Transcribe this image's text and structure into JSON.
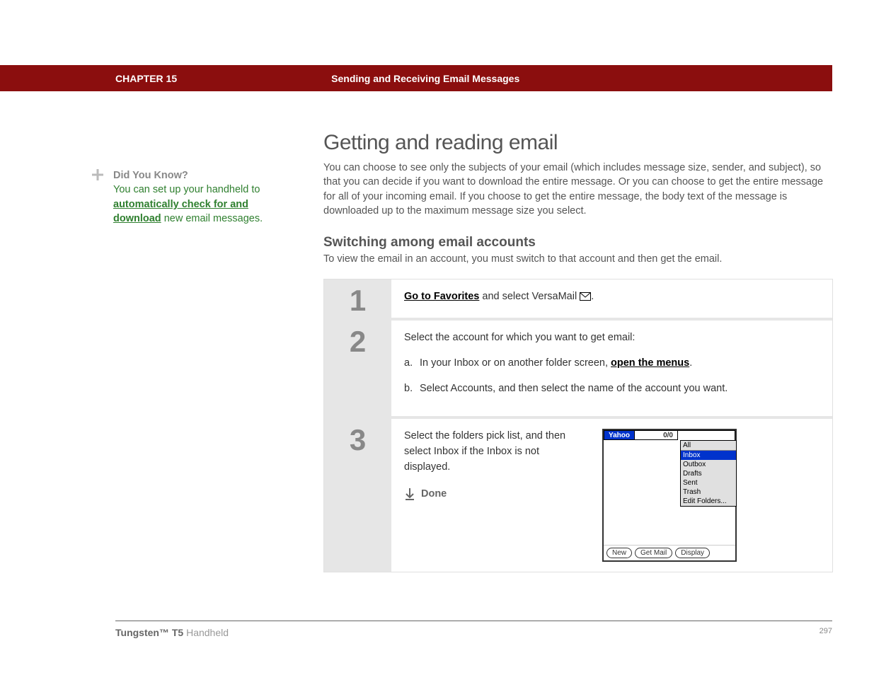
{
  "header": {
    "chapter": "CHAPTER 15",
    "title": "Sending and Receiving Email Messages"
  },
  "sidebar": {
    "dyk_title": "Did You Know?",
    "dyk_pre": "You can set up your handheld to ",
    "dyk_link": "automatically check for and download",
    "dyk_post": " new email messages."
  },
  "main": {
    "h1": "Getting and reading email",
    "intro": "You can choose to see only the subjects of your email (which includes message size, sender, and subject), so that you can decide if you want to download the entire message. Or you can choose to get the entire message for all of your incoming email. If you choose to get the entire message, the body text of the message is downloaded up to the maximum message size you select.",
    "h2": "Switching among email accounts",
    "sub_intro": "To view the email in an account, you must switch to that account and then get the email."
  },
  "steps": {
    "s1": {
      "num": "1",
      "link": "Go to Favorites",
      "rest": " and select VersaMail "
    },
    "s2": {
      "num": "2",
      "lead": "Select the account for which you want to get email:",
      "a_letter": "a.",
      "a_pre": "In your Inbox or on another folder screen, ",
      "a_link": "open the menus",
      "b_letter": "b.",
      "b_text": "Select Accounts, and then select the name of the account you want."
    },
    "s3": {
      "num": "3",
      "text": "Select the folders pick list, and then select Inbox if the Inbox is not displayed.",
      "done": "Done"
    }
  },
  "screenshot": {
    "account": "Yahoo",
    "count": "0/0",
    "folders": {
      "all": "All",
      "inbox": "Inbox",
      "outbox": "Outbox",
      "drafts": "Drafts",
      "sent": "Sent",
      "trash": "Trash",
      "edit": "Edit Folders..."
    },
    "buttons": {
      "new": "New",
      "get": "Get Mail",
      "display": "Display"
    }
  },
  "footer": {
    "product_bold": "Tungsten™ T5",
    "product_light": " Handheld",
    "page": "297"
  }
}
